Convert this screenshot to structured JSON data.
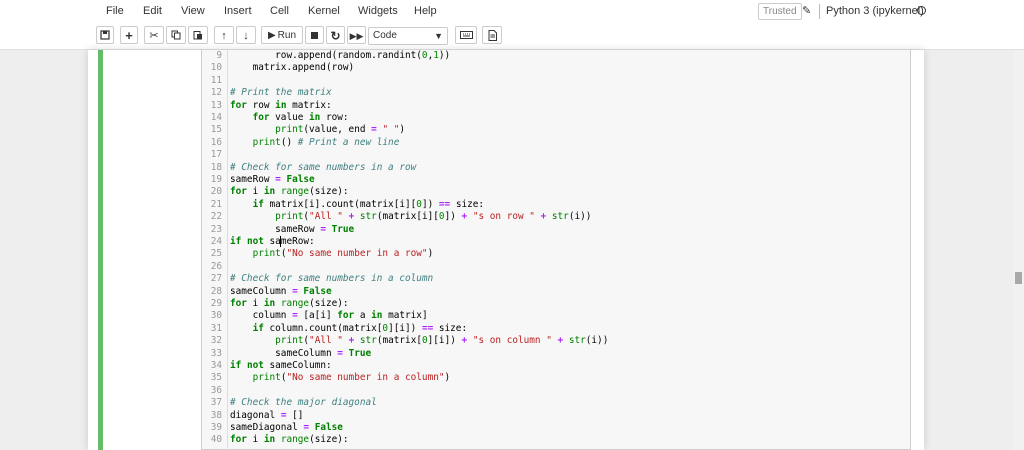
{
  "menu": [
    "File",
    "Edit",
    "View",
    "Insert",
    "Cell",
    "Kernel",
    "Widgets",
    "Help"
  ],
  "status": {
    "trusted": "Trusted",
    "kernel": "Python 3 (ipykernel)"
  },
  "toolbar": {
    "run_label": "Run",
    "cell_type": "Code"
  },
  "icons": {
    "save": "floppy-disk-icon",
    "add": "plus-icon",
    "cut": "scissors-icon",
    "copy": "copy-icon",
    "paste": "paste-icon",
    "up": "arrow-up-icon",
    "down": "arrow-down-icon",
    "run": "play-icon",
    "interrupt": "stop-icon",
    "restart": "restart-icon",
    "restart_run": "fast-forward-icon",
    "keyboard": "keyboard-icon",
    "palette": "command-palette-icon",
    "edit": "pencil-icon"
  },
  "colors": {
    "cell_selected": "#66bb6a",
    "keyword": "#008000",
    "string": "#ba2121",
    "comment": "#408080"
  },
  "code_lines": [
    {
      "n": "9",
      "text": "        row.append(random.randint(0,1))"
    },
    {
      "n": "10",
      "text": "    matrix.append(row)"
    },
    {
      "n": "11",
      "text": ""
    },
    {
      "n": "12",
      "text": "# Print the matrix"
    },
    {
      "n": "13",
      "text": "for row in matrix:"
    },
    {
      "n": "14",
      "text": "    for value in row:"
    },
    {
      "n": "15",
      "text": "        print(value, end = \" \")"
    },
    {
      "n": "16",
      "text": "    print() # Print a new line"
    },
    {
      "n": "17",
      "text": ""
    },
    {
      "n": "18",
      "text": "# Check for same numbers in a row"
    },
    {
      "n": "19",
      "text": "sameRow = False"
    },
    {
      "n": "20",
      "text": "for i in range(size):"
    },
    {
      "n": "21",
      "text": "    if matrix[i].count(matrix[i][0]) == size:"
    },
    {
      "n": "22",
      "text": "        print(\"All \" + str(matrix[i][0]) + \"s on row \" + str(i))"
    },
    {
      "n": "23",
      "text": "        sameRow = True"
    },
    {
      "n": "24",
      "text": "if not sameRow:"
    },
    {
      "n": "25",
      "text": "    print(\"No same number in a row\")"
    },
    {
      "n": "26",
      "text": ""
    },
    {
      "n": "27",
      "text": "# Check for same numbers in a column"
    },
    {
      "n": "28",
      "text": "sameColumn = False"
    },
    {
      "n": "29",
      "text": "for i in range(size):"
    },
    {
      "n": "30",
      "text": "    column = [a[i] for a in matrix]"
    },
    {
      "n": "31",
      "text": "    if column.count(matrix[0][i]) == size:"
    },
    {
      "n": "32",
      "text": "        print(\"All \" + str(matrix[0][i]) + \"s on column \" + str(i))"
    },
    {
      "n": "33",
      "text": "        sameColumn = True"
    },
    {
      "n": "34",
      "text": "if not sameColumn:"
    },
    {
      "n": "35",
      "text": "    print(\"No same number in a column\")"
    },
    {
      "n": "36",
      "text": ""
    },
    {
      "n": "37",
      "text": "# Check the major diagonal"
    },
    {
      "n": "38",
      "text": "diagonal = []"
    },
    {
      "n": "39",
      "text": "sameDiagonal = False"
    },
    {
      "n": "40",
      "text": "for i in range(size):"
    }
  ]
}
